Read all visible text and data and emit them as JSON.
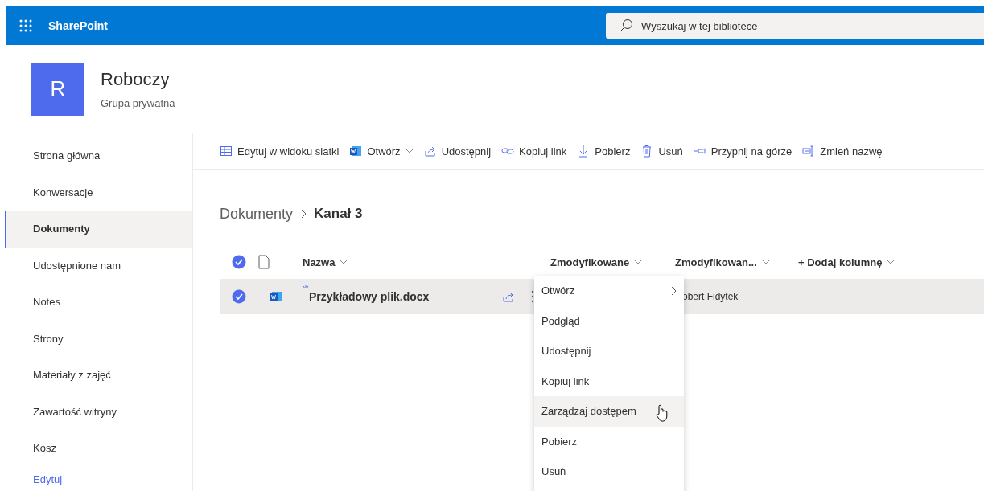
{
  "topbar": {
    "app_name": "SharePoint",
    "search": {
      "placeholder": "Wyszukaj w tej bibliotece"
    }
  },
  "site": {
    "logo_letter": "R",
    "title": "Roboczy",
    "subtitle": "Grupa prywatna"
  },
  "sidebar": {
    "items": [
      {
        "label": "Strona główna",
        "selected": false
      },
      {
        "label": "Konwersacje",
        "selected": false
      },
      {
        "label": "Dokumenty",
        "selected": true
      },
      {
        "label": "Udostępnione nam",
        "selected": false
      },
      {
        "label": "Notes",
        "selected": false
      },
      {
        "label": "Strony",
        "selected": false
      },
      {
        "label": "Materiały z zajęć",
        "selected": false
      },
      {
        "label": "Zawartość witryny",
        "selected": false
      },
      {
        "label": "Kosz",
        "selected": false
      }
    ],
    "edit_link": "Edytuj"
  },
  "command_bar": [
    {
      "kind": "grid",
      "label": "Edytuj w widoku siatki"
    },
    {
      "kind": "word",
      "label": "Otwórz",
      "dropdown": true
    },
    {
      "kind": "share",
      "label": "Udostępnij"
    },
    {
      "kind": "link",
      "label": "Kopiuj link"
    },
    {
      "kind": "download",
      "label": "Pobierz"
    },
    {
      "kind": "delete",
      "label": "Usuń"
    },
    {
      "kind": "pin",
      "label": "Przypnij na górze"
    },
    {
      "kind": "rename",
      "label": "Zmień nazwę"
    }
  ],
  "breadcrumb": [
    {
      "label": "Dokumenty",
      "current": false
    },
    {
      "label": "Kanał 3",
      "current": true
    }
  ],
  "table": {
    "all_checked": true,
    "columns": [
      {
        "label": "Nazwa"
      },
      {
        "label": "Zmodyfikowane"
      },
      {
        "label": "Zmodyfikowan..."
      },
      {
        "label": "+ Dodaj kolumnę"
      }
    ],
    "rows": [
      {
        "name": "Przykładowy plik.docx",
        "selected": true,
        "new": true,
        "modified_by": "obert Fidytek"
      }
    ]
  },
  "context_menu": [
    {
      "label": "Otwórz",
      "submenu": true,
      "highlighted": false
    },
    {
      "label": "Podgląd",
      "submenu": false,
      "highlighted": false
    },
    {
      "label": "Udostępnij",
      "submenu": false,
      "highlighted": false
    },
    {
      "label": "Kopiuj link",
      "submenu": false,
      "highlighted": false
    },
    {
      "label": "Zarządzaj dostępem",
      "submenu": false,
      "highlighted": true
    },
    {
      "label": "Pobierz",
      "submenu": false,
      "highlighted": false
    },
    {
      "label": "Usuń",
      "submenu": false,
      "highlighted": false
    }
  ]
}
